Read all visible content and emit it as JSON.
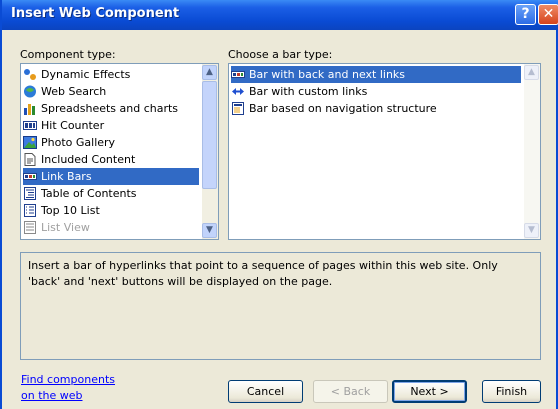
{
  "window": {
    "title": "Insert Web Component",
    "help_glyph": "?",
    "close_glyph": "✕"
  },
  "left": {
    "label": "Component type:",
    "items": [
      {
        "label": "Dynamic Effects",
        "icon": "dynamic-effects-icon"
      },
      {
        "label": "Web Search",
        "icon": "web-search-icon"
      },
      {
        "label": "Spreadsheets and charts",
        "icon": "spreadsheet-chart-icon"
      },
      {
        "label": "Hit Counter",
        "icon": "hit-counter-icon"
      },
      {
        "label": "Photo Gallery",
        "icon": "photo-gallery-icon"
      },
      {
        "label": "Included Content",
        "icon": "included-content-icon"
      },
      {
        "label": "Link Bars",
        "icon": "link-bars-icon",
        "selected": true
      },
      {
        "label": "Table of Contents",
        "icon": "table-of-contents-icon"
      },
      {
        "label": "Top 10 List",
        "icon": "top10-list-icon"
      },
      {
        "label": "List View",
        "icon": "list-view-icon",
        "disabled": true
      }
    ]
  },
  "right": {
    "label": "Choose a bar type:",
    "items": [
      {
        "label": "Bar with back and next links",
        "icon": "back-next-bar-icon",
        "selected": true
      },
      {
        "label": "Bar with custom links",
        "icon": "custom-links-icon"
      },
      {
        "label": "Bar based on navigation structure",
        "icon": "navigation-structure-icon"
      }
    ]
  },
  "description": "Insert a bar of hyperlinks that point to a sequence of pages within this web site.  Only 'back' and 'next' buttons will be displayed on the page.",
  "footer": {
    "link_line1": "Find components",
    "link_line2": "on the web",
    "cancel": "Cancel",
    "back": "< Back",
    "next": "Next >",
    "finish": "Finish"
  },
  "colors": {
    "title_bar": "#0a4bd4",
    "selection": "#316ac5",
    "dialog_bg": "#ece9d8"
  }
}
